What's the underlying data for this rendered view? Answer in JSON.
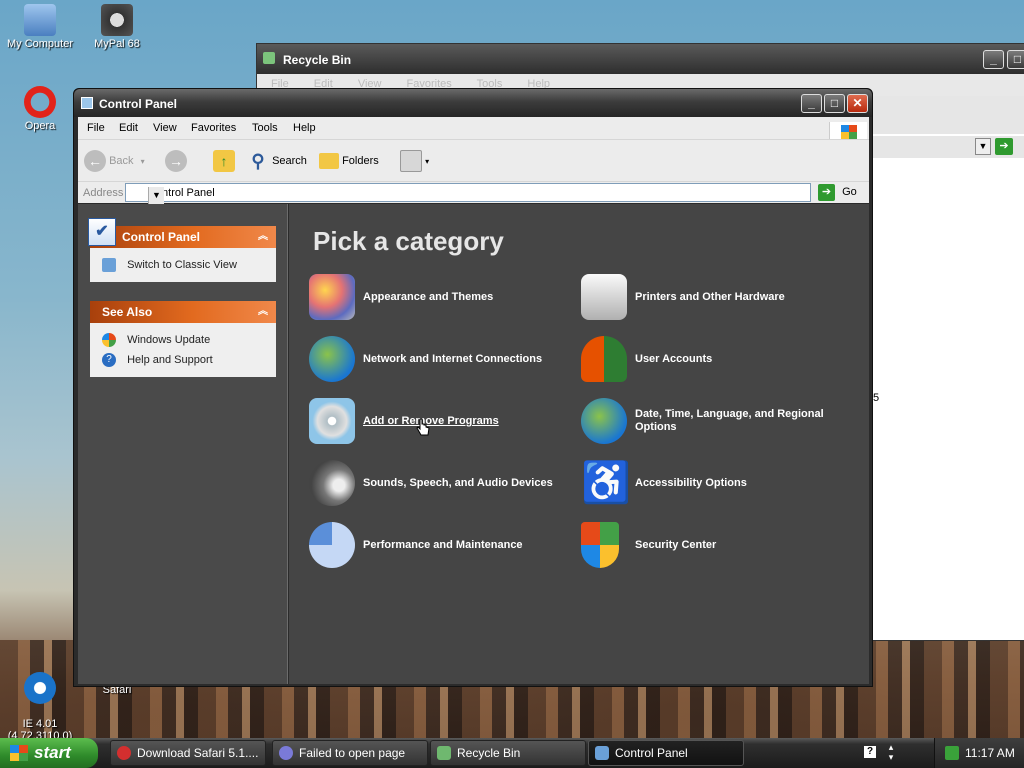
{
  "desktop": {
    "icons": [
      {
        "label": "My Computer"
      },
      {
        "label": "MyPal 68"
      },
      {
        "label": "Opera"
      },
      {
        "label": "IE 4.01\n(4.72.3110.0)"
      },
      {
        "label": "Safari"
      }
    ],
    "partial_text": "5"
  },
  "recycle_bin_window": {
    "title": "Recycle Bin",
    "menu": [
      "File",
      "Edit",
      "View",
      "Favorites",
      "Tools",
      "Help"
    ]
  },
  "control_panel_window": {
    "title": "Control Panel",
    "menu": [
      "File",
      "Edit",
      "View",
      "Favorites",
      "Tools",
      "Help"
    ],
    "toolbar": {
      "back": "Back",
      "search": "Search",
      "folders": "Folders"
    },
    "address": {
      "label": "Address",
      "value": "Control Panel",
      "go": "Go"
    },
    "left_pane": {
      "control_panel_header": "Control Panel",
      "control_panel_items": [
        "Switch to Classic View"
      ],
      "see_also_header": "See Also",
      "see_also_items": [
        "Windows Update",
        "Help and Support"
      ]
    },
    "content": {
      "heading": "Pick a category",
      "categories": [
        {
          "label": "Appearance and Themes",
          "icon": "appearance-themes-icon"
        },
        {
          "label": "Printers and Other Hardware",
          "icon": "printer-icon"
        },
        {
          "label": "Network and Internet Connections",
          "icon": "network-icon"
        },
        {
          "label": "User Accounts",
          "icon": "user-accounts-icon"
        },
        {
          "label": "Add or Remove Programs",
          "icon": "add-remove-programs-icon"
        },
        {
          "label": "Date, Time, Language, and Regional Options",
          "icon": "date-time-globe-icon"
        },
        {
          "label": "Sounds, Speech, and Audio Devices",
          "icon": "sounds-icon"
        },
        {
          "label": "Accessibility Options",
          "icon": "accessibility-icon"
        },
        {
          "label": "Performance and Maintenance",
          "icon": "performance-icon"
        },
        {
          "label": "Security Center",
          "icon": "security-shield-icon"
        }
      ]
    }
  },
  "taskbar": {
    "start": "start",
    "tasks": [
      {
        "label": "Download Safari 5.1....",
        "color": "#d32f2f"
      },
      {
        "label": "Failed to open page",
        "color": "#7a7ad8"
      },
      {
        "label": "Recycle Bin",
        "color": "#6fb86f"
      },
      {
        "label": "Control Panel",
        "color": "#6aa0d8"
      }
    ],
    "clock": "11:17 AM"
  }
}
